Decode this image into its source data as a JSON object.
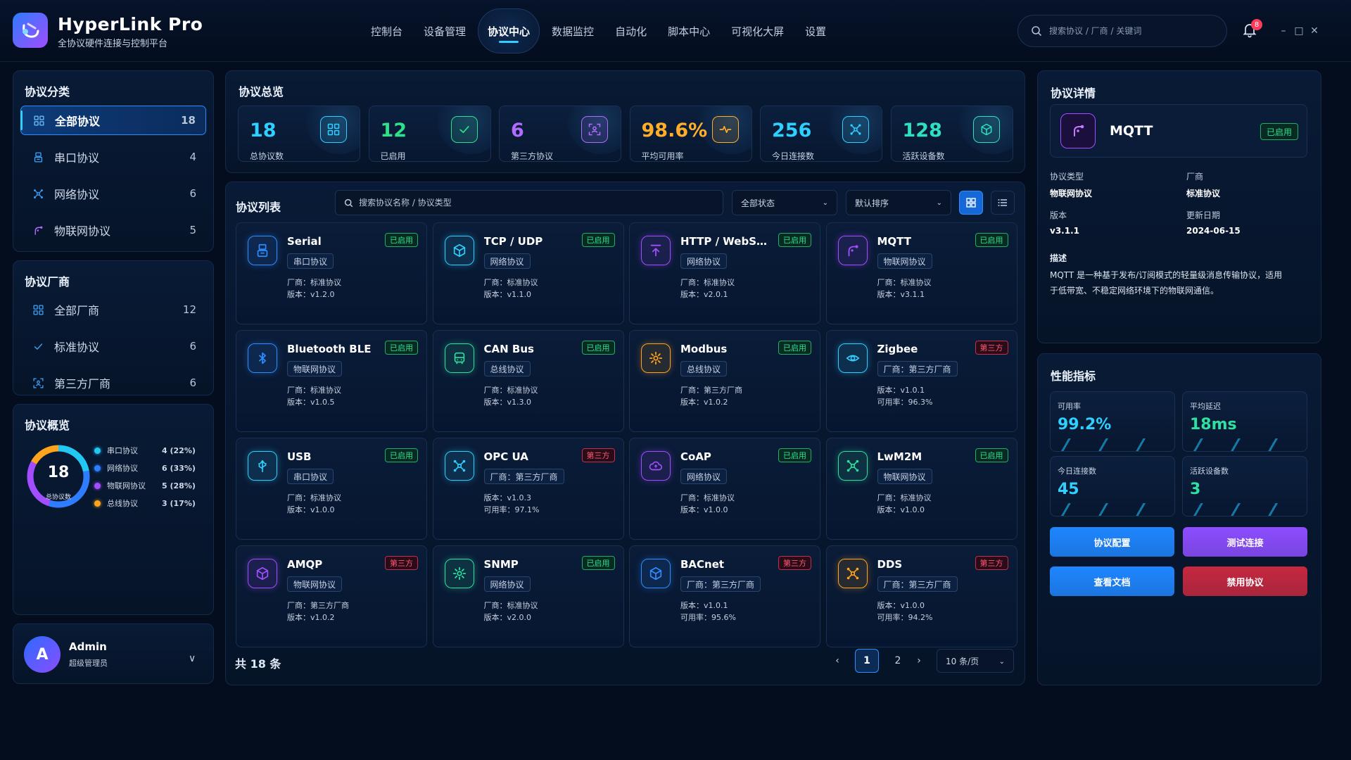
{
  "app": {
    "title": "HyperLink Pro",
    "subtitle": "全协议硬件连接与控制平台"
  },
  "nav": {
    "items": [
      "控制台",
      "设备管理",
      "协议中心",
      "数据监控",
      "自动化",
      "脚本中心",
      "可视化大屏",
      "设置"
    ],
    "active": "协议中心"
  },
  "search": {
    "placeholder": "搜索协议 / 厂商 / 关键词"
  },
  "notifications": {
    "count": "8"
  },
  "categories": {
    "title": "协议分类",
    "items": [
      {
        "label": "全部协议",
        "count": "18",
        "icon": "grid-icon"
      },
      {
        "label": "串口协议",
        "count": "4",
        "icon": "serial-icon"
      },
      {
        "label": "网络协议",
        "count": "6",
        "icon": "network-icon"
      },
      {
        "label": "物联网协议",
        "count": "5",
        "icon": "iot-icon"
      }
    ]
  },
  "vendors": {
    "title": "协议厂商",
    "items": [
      {
        "label": "全部厂商",
        "count": "12",
        "icon": "grid-icon"
      },
      {
        "label": "标准协议",
        "count": "6",
        "icon": "check-icon"
      },
      {
        "label": "第三方厂商",
        "count": "6",
        "icon": "scan-icon"
      }
    ]
  },
  "overview_mini": {
    "title": "协议概览",
    "total": "18",
    "total_label": "总协议数",
    "legend": [
      {
        "label": "串口协议",
        "value": "4 (22%)",
        "color": "#22c7f2",
        "pct": 22
      },
      {
        "label": "网络协议",
        "value": "6 (33%)",
        "color": "#2f7dff",
        "pct": 33
      },
      {
        "label": "物联网协议",
        "value": "5 (28%)",
        "color": "#a24dff",
        "pct": 28
      },
      {
        "label": "总线协议",
        "value": "3 (17%)",
        "color": "#ffa41c",
        "pct": 17
      }
    ]
  },
  "user": {
    "initial": "A",
    "name": "Admin",
    "role": "超级管理员"
  },
  "summary": {
    "title": "协议总览",
    "stats": [
      {
        "value": "18",
        "label": "总协议数",
        "color": "#2fd0ff",
        "icon": "grid-icon"
      },
      {
        "value": "12",
        "label": "已启用",
        "color": "#2fe08a",
        "icon": "check-icon"
      },
      {
        "value": "6",
        "label": "第三方协议",
        "color": "#b06bff",
        "icon": "scan-icon"
      },
      {
        "value": "98.6%",
        "label": "平均可用率",
        "color": "#ffae2b",
        "icon": "pulse-icon"
      },
      {
        "value": "256",
        "label": "今日连接数",
        "color": "#2fd0ff",
        "icon": "network-icon"
      },
      {
        "value": "128",
        "label": "活跃设备数",
        "color": "#2fe0c0",
        "icon": "cube-icon"
      }
    ]
  },
  "list": {
    "title": "协议列表",
    "search_placeholder": "搜索协议名称 / 协议类型",
    "status_filter": "全部状态",
    "sort": "默认排序",
    "total_text": "共 18 条",
    "pages": [
      "1",
      "2"
    ],
    "page_size": "10 条/页",
    "prev": "‹",
    "next": "›"
  },
  "protocols": [
    {
      "name": "Serial",
      "status": "已启用",
      "tag": "串口协议",
      "line1": "厂商：标准协议",
      "line2": "版本：v1.2.0",
      "color": "#2f8dff",
      "icon": "serial-icon",
      "third": false
    },
    {
      "name": "TCP / UDP",
      "status": "已启用",
      "tag": "网络协议",
      "line1": "厂商：标准协议",
      "line2": "版本：v1.1.0",
      "color": "#2fd0ff",
      "icon": "cube-icon",
      "third": false
    },
    {
      "name": "HTTP / WebSocket",
      "status": "已启用",
      "tag": "网络协议",
      "line1": "厂商：标准协议",
      "line2": "版本：v2.0.1",
      "color": "#a24dff",
      "icon": "upload-icon",
      "third": false
    },
    {
      "name": "MQTT",
      "status": "已启用",
      "tag": "物联网协议",
      "line1": "厂商：标准协议",
      "line2": "版本：v3.1.1",
      "color": "#a24dff",
      "icon": "iot-icon",
      "third": false
    },
    {
      "name": "Bluetooth BLE",
      "status": "已启用",
      "tag": "物联网协议",
      "line1": "厂商：标准协议",
      "line2": "版本：v1.0.5",
      "color": "#2f8dff",
      "icon": "bluetooth-icon",
      "third": false
    },
    {
      "name": "CAN Bus",
      "status": "已启用",
      "tag": "总线协议",
      "line1": "厂商：标准协议",
      "line2": "版本：v1.3.0",
      "color": "#2fe0a0",
      "icon": "bus-icon",
      "third": false
    },
    {
      "name": "Modbus",
      "status": "已启用",
      "tag": "总线协议",
      "line1": "厂商：第三方厂商",
      "line2": "版本：v1.0.2",
      "color": "#ffa41c",
      "icon": "gear-icon",
      "third": false
    },
    {
      "name": "Zigbee",
      "status": "第三方",
      "tag": "厂商：第三方厂商",
      "line1": "版本：v1.0.1",
      "line2": "可用率：96.3%",
      "color": "#2fd0ff",
      "icon": "eye-icon",
      "third": true
    },
    {
      "name": "USB",
      "status": "已启用",
      "tag": "串口协议",
      "line1": "厂商：标准协议",
      "line2": "版本：v1.0.0",
      "color": "#2fd0ff",
      "icon": "usb-icon",
      "third": false
    },
    {
      "name": "OPC UA",
      "status": "第三方",
      "tag": "厂商：第三方厂商",
      "line1": "版本：v1.0.3",
      "line2": "可用率：97.1%",
      "color": "#2fd0ff",
      "icon": "network-icon",
      "third": true
    },
    {
      "name": "CoAP",
      "status": "已启用",
      "tag": "网络协议",
      "line1": "厂商：标准协议",
      "line2": "版本：v1.0.0",
      "color": "#a24dff",
      "icon": "cloud-icon",
      "third": false
    },
    {
      "name": "LwM2M",
      "status": "已启用",
      "tag": "物联网协议",
      "line1": "厂商：标准协议",
      "line2": "版本：v1.0.0",
      "color": "#2fe0a0",
      "icon": "network-icon",
      "third": false
    },
    {
      "name": "AMQP",
      "status": "第三方",
      "tag": "物联网协议",
      "line1": "厂商：第三方厂商",
      "line2": "版本：v1.0.2",
      "color": "#a24dff",
      "icon": "cube-icon",
      "third": true
    },
    {
      "name": "SNMP",
      "status": "已启用",
      "tag": "网络协议",
      "line1": "厂商：标准协议",
      "line2": "版本：v2.0.0",
      "color": "#2fe0a0",
      "icon": "gear-icon",
      "third": false
    },
    {
      "name": "BACnet",
      "status": "第三方",
      "tag": "厂商：第三方厂商",
      "line1": "版本：v1.0.1",
      "line2": "可用率：95.6%",
      "color": "#2f8dff",
      "icon": "cube-icon",
      "third": true
    },
    {
      "name": "DDS",
      "status": "第三方",
      "tag": "厂商：第三方厂商",
      "line1": "版本：v1.0.0",
      "line2": "可用率：94.2%",
      "color": "#ffa41c",
      "icon": "network-icon",
      "third": true
    }
  ],
  "detail": {
    "title": "协议详情",
    "name": "MQTT",
    "status": "已启用",
    "type_label": "协议类型",
    "type_value": "物联网协议",
    "vendor_label": "厂商",
    "vendor_value": "标准协议",
    "version_label": "版本",
    "version_value": "v3.1.1",
    "date_label": "更新日期",
    "date_value": "2024-06-15",
    "desc_label": "描述",
    "desc_line1": "MQTT 是一种基于发布/订阅模式的轻量级消息传输协议，适用",
    "desc_line2": "于低带宽、不稳定网络环境下的物联网通信。"
  },
  "metrics": {
    "title": "性能指标",
    "items": [
      {
        "label": "可用率",
        "value": "99.2%",
        "color": "#2fd0ff"
      },
      {
        "label": "平均延迟",
        "value": "18ms",
        "color": "#2fe0a0"
      },
      {
        "label": "今日连接数",
        "value": "45",
        "color": "#2fd0ff"
      },
      {
        "label": "活跃设备数",
        "value": "3",
        "color": "#2fe0a0"
      }
    ],
    "buttons": [
      {
        "label": "协议配置",
        "color": "#1f86ff"
      },
      {
        "label": "测试连接",
        "color": "#8d4dff"
      },
      {
        "label": "查看文档",
        "color": "#1f86ff"
      },
      {
        "label": "禁用协议",
        "color": "#c5283f"
      }
    ]
  }
}
